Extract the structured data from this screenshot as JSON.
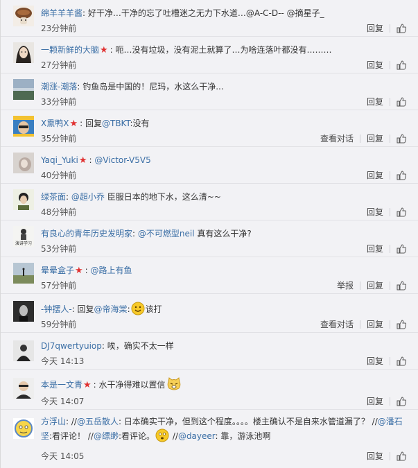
{
  "comments": [
    {
      "name": "绵羊羊羊酱",
      "text": "好干净…干净的忘了吐槽迷之无力下水道…@A-C-D-- @摘星子_",
      "time": "23分钟前",
      "reply": "回复"
    },
    {
      "name": "一颗新鲜的大脑",
      "text": "呃…没有垃圾，没有泥土就算了…为啥连落叶都没有………",
      "time": "27分钟前",
      "reply": "回复"
    },
    {
      "name": "潮涨-潮落",
      "text": "钓鱼岛是中国的！尼玛，水这么干净...",
      "time": "33分钟前",
      "reply": "回复"
    },
    {
      "name": "X熏鸭X",
      "text_pre": "回复",
      "mention": "@TBKT",
      "text_post": ":没有",
      "time": "35分钟前",
      "view": "查看对话",
      "reply": "回复"
    },
    {
      "name": "Yaqi_Yuki",
      "mention": "@Victor-V5V5",
      "time": "40分钟前",
      "reply": "回复"
    },
    {
      "name": "绿茶面",
      "mention": "@超小乔",
      "text_post": " 臣服日本的地下水，这么清~~",
      "time": "48分钟前",
      "reply": "回复"
    },
    {
      "name": "有良心的青年历史发明家",
      "mention": "@不可燃型neil",
      "text_post": " 真有这么干净?",
      "time": "53分钟前",
      "reply": "回复",
      "avatar_text": "演讲学习"
    },
    {
      "name": "晕晕盒子",
      "mention": "@路上有鱼",
      "time": "57分钟前",
      "report": "举报",
      "reply": "回复"
    },
    {
      "name": "-钟摆人-",
      "text_pre": "回复",
      "mention": "@帝海棠",
      "text_post": ":",
      "text_after": "该打",
      "time": "59分钟前",
      "view": "查看对话",
      "reply": "回复"
    },
    {
      "name": "DJ7qwertyuiop",
      "text": "唉，确实不太一样",
      "time": "今天 14:13",
      "reply": "回复"
    },
    {
      "name": "本是一文青",
      "text": "水干净得难以置信",
      "time": "今天 14:07",
      "reply": "回复"
    },
    {
      "name": "方浮山",
      "seg1": "//",
      "m1": "@五岳散人",
      "seg2": ": 日本确实干净，但到这个程度。。。。楼主确认不是自来水管道漏了？ //",
      "m2": "@潘石坚",
      "seg3": ":看评论！ //",
      "m3": "@缥缈",
      "seg4": ":看评论。",
      "seg5": " //",
      "m4": "@dayeer",
      "seg6": ": 靠，游泳池啊",
      "time": "今天 14:05",
      "reply": "回复"
    }
  ],
  "colors": {
    "link": "#3a6ea5",
    "star": "#e03131",
    "background": "#f2f2f5"
  },
  "icons": [
    "thumbs-up-icon",
    "red-star-icon",
    "smiley-emoji",
    "cat-emoji"
  ]
}
